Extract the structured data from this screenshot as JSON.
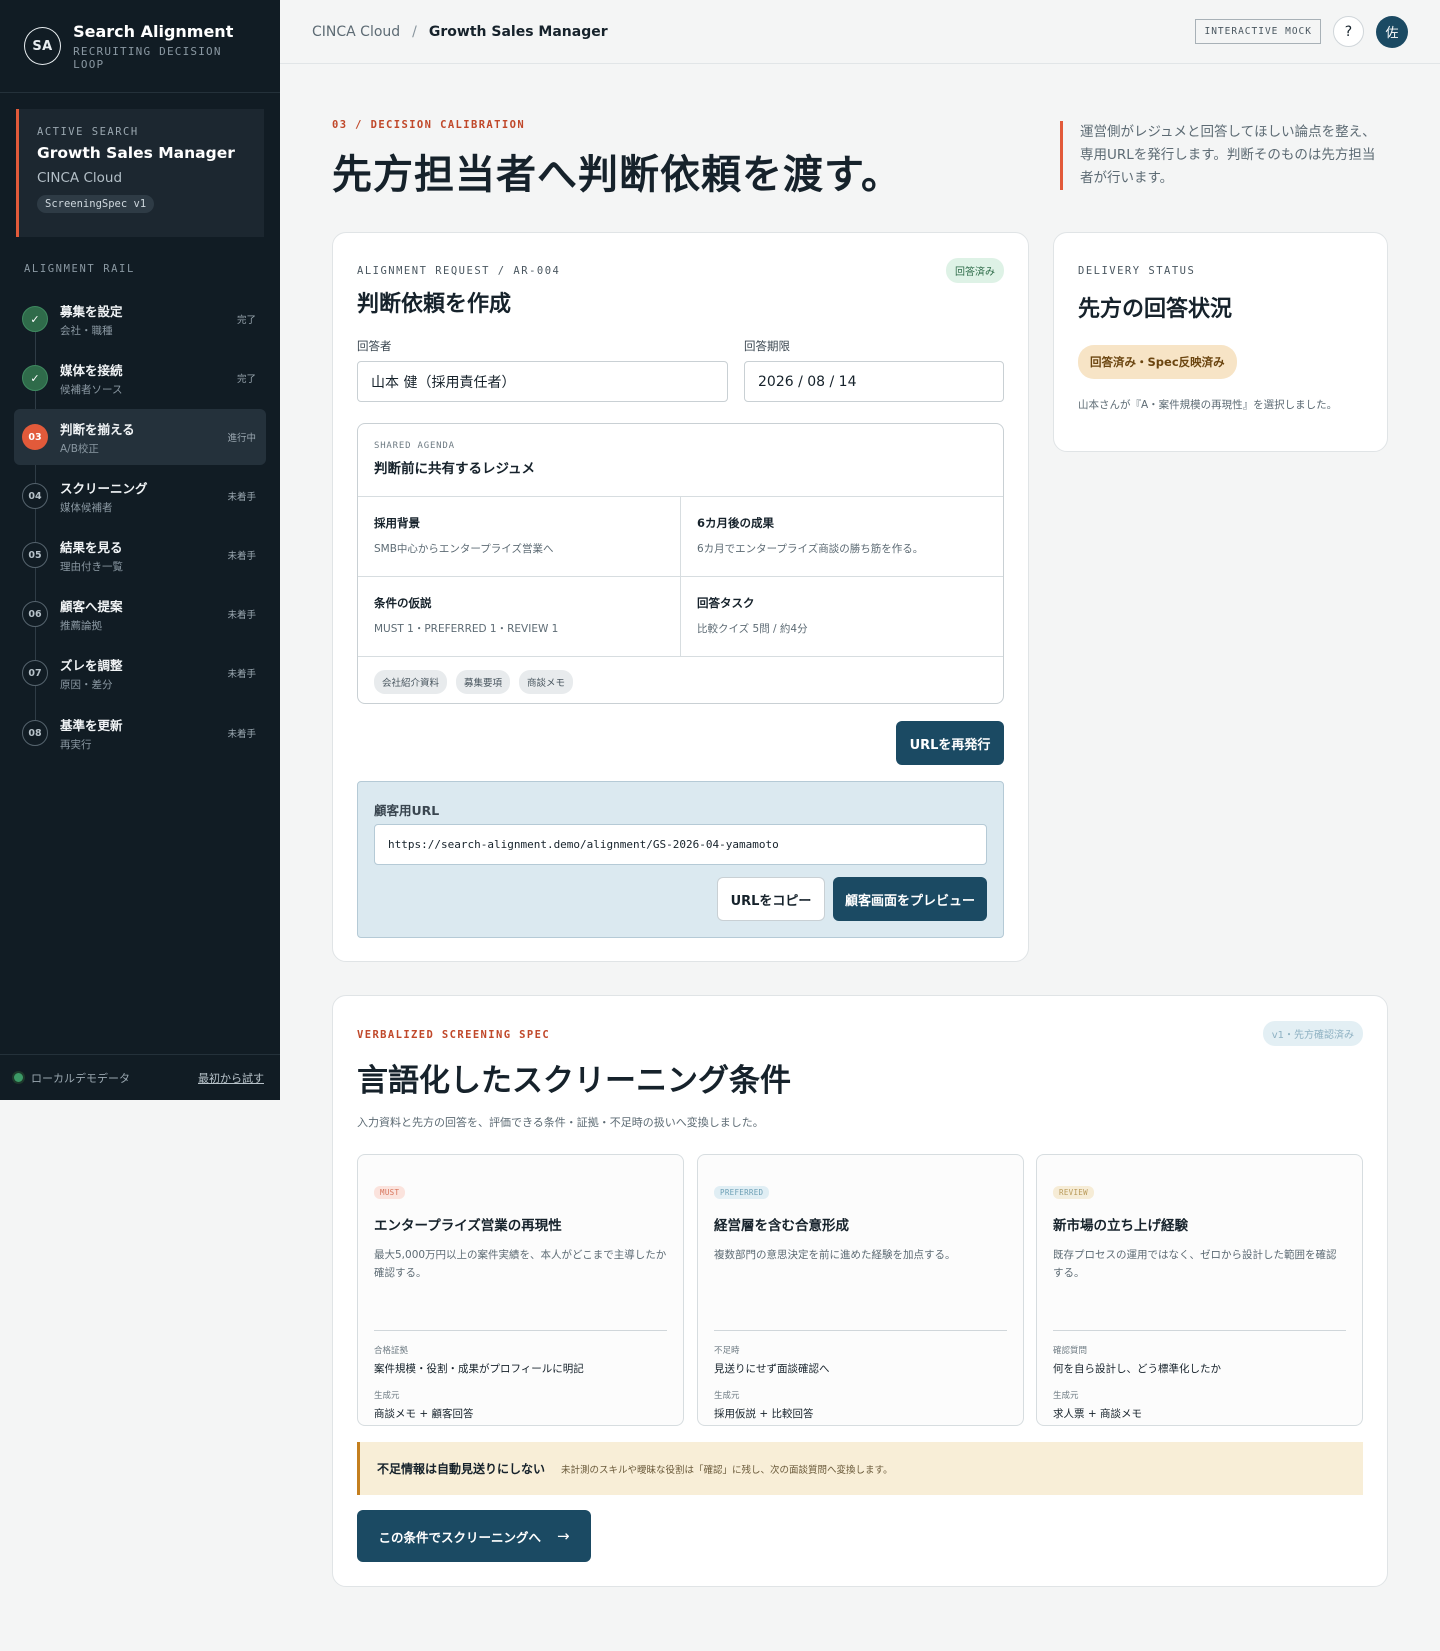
{
  "brand": {
    "logo": "SA",
    "title": "Search Alignment",
    "subtitle": "RECRUITING DECISION LOOP"
  },
  "active_search": {
    "label": "ACTIVE SEARCH",
    "role": "Growth Sales Manager",
    "company": "CINCA Cloud",
    "badge": "ScreeningSpec v1"
  },
  "rail": {
    "label": "ALIGNMENT RAIL",
    "items": [
      {
        "marker": "✓",
        "title": "募集を設定",
        "sub": "会社・職種",
        "status": "完了"
      },
      {
        "marker": "✓",
        "title": "媒体を接続",
        "sub": "候補者ソース",
        "status": "完了"
      },
      {
        "marker": "03",
        "title": "判断を揃える",
        "sub": "A/B校正",
        "status": "進行中"
      },
      {
        "marker": "04",
        "title": "スクリーニング",
        "sub": "媒体候補者",
        "status": "未着手"
      },
      {
        "marker": "05",
        "title": "結果を見る",
        "sub": "理由付き一覧",
        "status": "未着手"
      },
      {
        "marker": "06",
        "title": "顧客へ提案",
        "sub": "推薦論拠",
        "status": "未着手"
      },
      {
        "marker": "07",
        "title": "ズレを調整",
        "sub": "原因・差分",
        "status": "未着手"
      },
      {
        "marker": "08",
        "title": "基準を更新",
        "sub": "再実行",
        "status": "未着手"
      }
    ]
  },
  "footer": {
    "demo_label": "ローカルデモデータ",
    "restart_link": "最初から試す"
  },
  "topbar": {
    "crumb_root": "CINCA Cloud",
    "crumb_sep": "/",
    "crumb_current": "Growth Sales Manager",
    "mock_badge": "INTERACTIVE MOCK",
    "help": "?",
    "avatar": "佐"
  },
  "header": {
    "eyebrow": "03 / DECISION CALIBRATION",
    "title": "先方担当者へ判断依頼を渡す。",
    "note": "運営側がレジュメと回答してほしい論点を整え、専用URLを発行します。判断そのものは先方担当者が行います。"
  },
  "request": {
    "eyebrow": "ALIGNMENT REQUEST / AR-004",
    "status": "回答済み",
    "title": "判断依頼を作成",
    "respondent_label": "回答者",
    "respondent_value": "山本 健（採用責任者）",
    "deadline_label": "回答期限",
    "deadline_value": "2026 / 08 / 14",
    "agenda": {
      "sub": "SHARED AGENDA",
      "title": "判断前に共有するレジュメ",
      "cells": [
        {
          "title": "採用背景",
          "value": "SMB中心からエンタープライズ営業へ"
        },
        {
          "title": "6カ月後の成果",
          "value": "6カ月でエンタープライズ商談の勝ち筋を作る。"
        },
        {
          "title": "条件の仮説",
          "value": "MUST 1・PREFERRED 1・REVIEW 1"
        },
        {
          "title": "回答タスク",
          "value": "比較クイズ 5問 / 約4分"
        }
      ],
      "chips": [
        "会社紹介資料",
        "募集要項",
        "商談メモ"
      ]
    },
    "reissue_button": "URLを再発行",
    "url_label": "顧客用URL",
    "url_value": "https://search-alignment.demo/alignment/GS-2026-04-yamamoto",
    "copy_button": "URLをコピー",
    "preview_button": "顧客画面をプレビュー"
  },
  "delivery": {
    "eyebrow": "DELIVERY STATUS",
    "title": "先方の回答状況",
    "pill": "回答済み・Spec反映済み",
    "note": "山本さんが『A・案件規模の再現性』を選択しました。"
  },
  "spec": {
    "eyebrow": "VERBALIZED SCREENING SPEC",
    "pill": "v1・先方確認済み",
    "title": "言語化したスクリーニング条件",
    "desc": "入力資料と先方の回答を、評価できる条件・証拠・不足時の扱いへ変換しました。",
    "criteria": [
      {
        "tag": "MUST",
        "title": "エンタープライズ営業の再現性",
        "desc": "最大5,000万円以上の案件実績を、本人がどこまで主導したか確認する。",
        "k1": "合格証拠",
        "v1": "案件規模・役割・成果がプロフィールに明記",
        "k2": "生成元",
        "v2": "商談メモ + 顧客回答"
      },
      {
        "tag": "PREFERRED",
        "title": "経営層を含む合意形成",
        "desc": "複数部門の意思決定を前に進めた経験を加点する。",
        "k1": "不足時",
        "v1": "見送りにせず面談確認へ",
        "k2": "生成元",
        "v2": "採用仮説 + 比較回答"
      },
      {
        "tag": "REVIEW",
        "title": "新市場の立ち上げ経験",
        "desc": "既存プロセスの運用ではなく、ゼロから設計した範囲を確認する。",
        "k1": "確認質問",
        "v1": "何を自ら設計し、どう標準化したか",
        "k2": "生成元",
        "v2": "求人票 + 商談メモ"
      }
    ],
    "warn_title": "不足情報は自動見送りにしない",
    "warn_desc": "未計測のスキルや曖昧な役割は「確認」に残し、次の面談質問へ変換します。",
    "cta": "この条件でスクリーニングへ",
    "cta_arrow": "→"
  }
}
